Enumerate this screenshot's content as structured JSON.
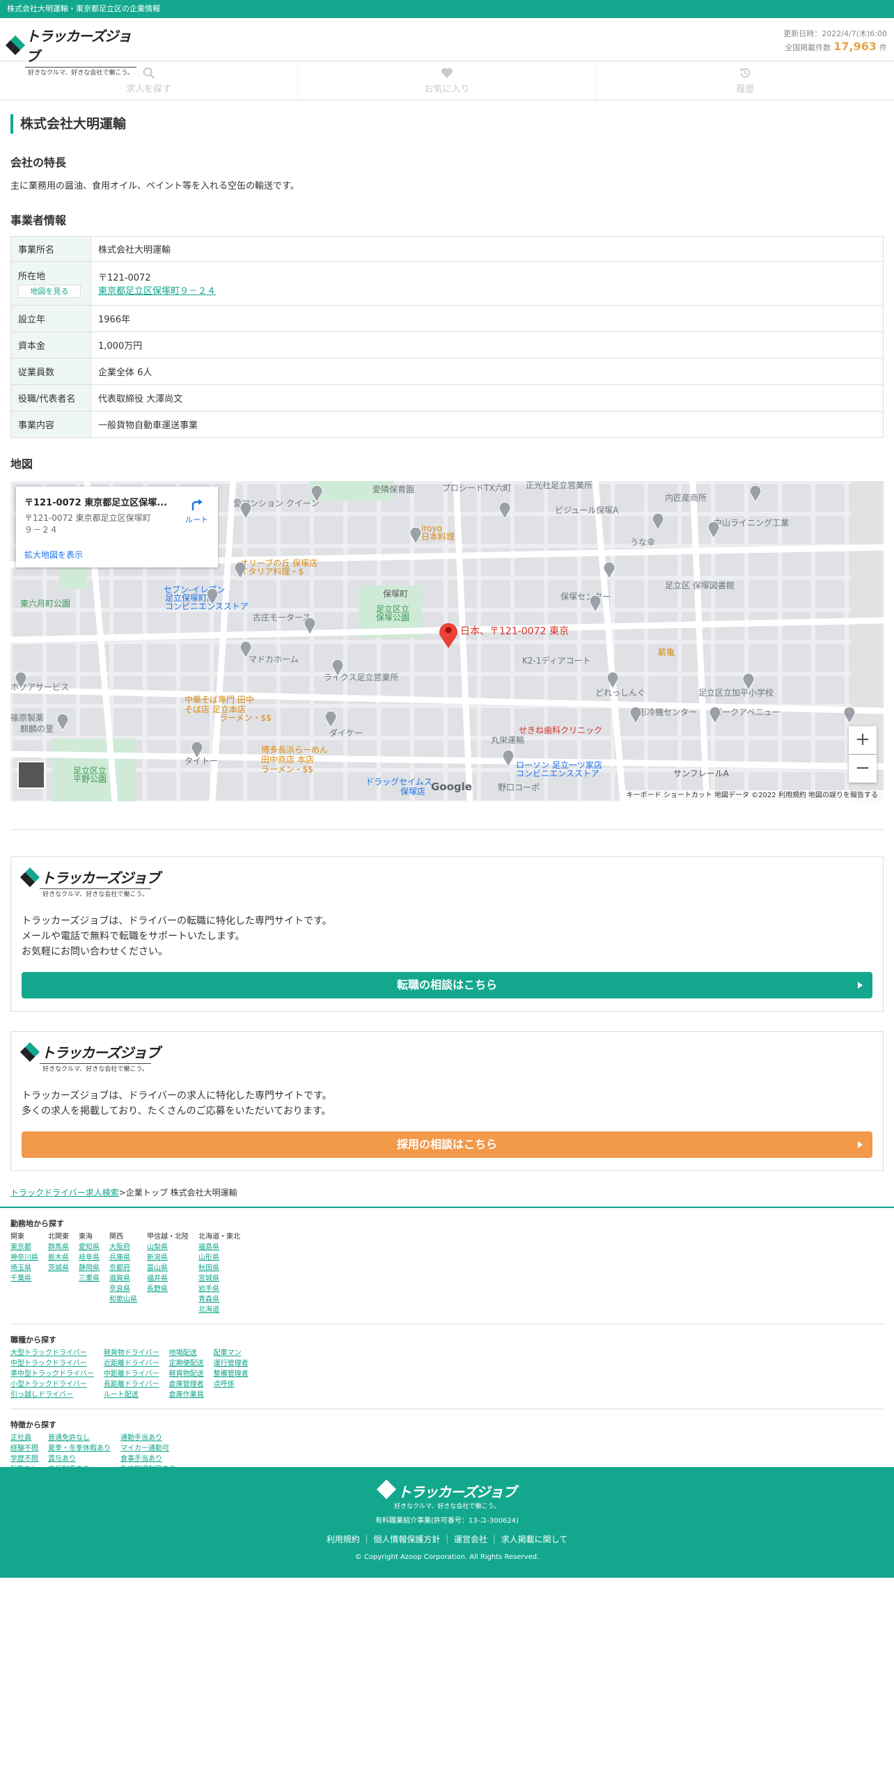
{
  "topbar": {
    "text": "株式会社大明運輸・東京都足立区の企業情報"
  },
  "header": {
    "logo_text": "トラッカーズジョブ",
    "logo_tagline": "好きなクルマ、好きな会社で働こう。",
    "updated_label": "更新日時：2022/4/7(木)6:00",
    "total_label": "全国掲載件数",
    "total_count": "17,963",
    "total_unit": "件"
  },
  "nav": {
    "items": [
      {
        "label": "求人を探す",
        "icon": "search-icon"
      },
      {
        "label": "お気に入り",
        "icon": "heart-icon"
      },
      {
        "label": "履歴",
        "icon": "history-icon"
      }
    ]
  },
  "company": {
    "name": "株式会社大明運輸",
    "features_heading": "会社の特長",
    "features_text": "主に業務用の醤油、食用オイル、ペイント等を入れる空缶の輸送です。",
    "info_heading": "事業者情報",
    "info": [
      {
        "label": "事業所名",
        "value": "株式会社大明運輸"
      },
      {
        "label": "所在地",
        "value": "〒121-0072",
        "link": "東京都足立区保塚町９－２４",
        "map_button": "地図を見る"
      },
      {
        "label": "設立年",
        "value": "1966年"
      },
      {
        "label": "資本金",
        "value": "1,000万円"
      },
      {
        "label": "従業員数",
        "value": "企業全体 6人"
      },
      {
        "label": "役職/代表者名",
        "value": "代表取締役 大澤尚文"
      },
      {
        "label": "事業内容",
        "value": "一般貨物自動車運送事業"
      }
    ]
  },
  "map": {
    "heading": "地図",
    "card_title": "〒121-0072 東京都足立区保塚...",
    "card_address": "〒121-0072 東京都足立区保塚町９－２４",
    "route_label": "ルート",
    "enlarge_label": "拡大地図を表示",
    "pin_label": "日本、〒121-0072 東京",
    "zoom_in": "+",
    "zoom_out": "−",
    "footer_text": "キーボード ショートカット  地図データ ©2022  利用規約  地図の誤りを報告する",
    "google": "Google",
    "places": [
      "愛隣保育園",
      "プロシードTX六町",
      "正光社足立営業所",
      "内匠産商所",
      "ビジュール保塚A",
      "中山ライニング工業",
      "うな幸",
      "足立区 保塚図書館",
      "保塚センター",
      "iroyo",
      "日本料理",
      "オリーブの丘 保塚店",
      "イタリア料理・$",
      "セブン-イレブン",
      "足立保塚町店",
      "コンビニエンスストア",
      "保塚町",
      "足立区立",
      "保塚公園",
      "東六月町公園",
      "古庄モータース",
      "マドカホーム",
      "K2-1ディアコート",
      "薪亀",
      "どれっしんぐ",
      "足立区立加平小学校",
      "ライクス足立営業所",
      "中華そば専門 田中",
      "そば店 足立本店",
      "ラーメン・$$",
      "足立区立",
      "平野公園",
      "博多長浜らーめん",
      "田中商店 本店",
      "ラーメン・$$",
      "ドラッグセイムス",
      "保塚店",
      "丸栄運輸",
      "せきね歯科クリニック",
      "ローソン 足立一ツ家店",
      "コンビニエンスストア",
      "鎌形冷機センター",
      "パークアベニュー",
      "サンフレールA",
      "ダイケー",
      "タイトー",
      "ホクアサービス",
      "篠原製薬",
      "野口コーポ",
      "愛マンション クイーン",
      "麒麟の里"
    ]
  },
  "cta1": {
    "logo_text": "トラッカーズジョブ",
    "logo_tagline": "好きなクルマ、好きな会社で働こう。",
    "lines": [
      "トラッカーズジョブは、ドライバーの転職に特化した専門サイトです。",
      "メールや電話で無料で転職をサポートいたします。",
      "お気軽にお問い合わせください。"
    ],
    "button": "転職の相談はこちら",
    "color": "#13a88e"
  },
  "cta2": {
    "logo_text": "トラッカーズジョブ",
    "logo_tagline": "好きなクルマ、好きな会社で働こう。",
    "lines": [
      "トラッカーズジョブは、ドライバーの求人に特化した専門サイトです。",
      "多くの求人を掲載しており、たくさんのご応募をいただいております。"
    ],
    "button": "採用の相談はこちら",
    "color": "#f2994a"
  },
  "breadcrumb": {
    "link": "トラックドライバー求人検索",
    "sep": ">",
    "rest": "企業トップ 株式会社大明運輸"
  },
  "footer_links": {
    "area_title": "勤務地から探す",
    "areas": [
      {
        "head": "関東",
        "items": [
          "東京都",
          "神奈川県",
          "埼玉県",
          "千葉県"
        ]
      },
      {
        "head": "北関東",
        "items": [
          "群馬県",
          "栃木県",
          "茨城県"
        ]
      },
      {
        "head": "東海",
        "items": [
          "愛知県",
          "岐阜県",
          "静岡県",
          "三重県"
        ]
      },
      {
        "head": "関西",
        "items": [
          "大阪府",
          "兵庫県",
          "京都府",
          "滋賀県",
          "奈良県",
          "和歌山県"
        ]
      },
      {
        "head": "甲信越・北陸",
        "items": [
          "山梨県",
          "新潟県",
          "富山県",
          "福井県",
          "長野県"
        ]
      },
      {
        "head": "北海道・東北",
        "items": [
          "福島県",
          "山形県",
          "秋田県",
          "宮城県",
          "岩手県",
          "青森県",
          "北海道"
        ]
      }
    ],
    "job_title": "職種から探す",
    "jobs": [
      [
        "大型トラックドライバー",
        "中型トラックドライバー",
        "準中型トラックドライバー",
        "小型トラックドライバー",
        "引っ越しドライバー"
      ],
      [
        "軽貨物ドライバー",
        "近距離ドライバー",
        "中距離ドライバー",
        "長距離ドライバー",
        "ルート配送"
      ],
      [
        "地場配送",
        "定期便配送",
        "軽貨物配送",
        "倉庫管理者",
        "倉庫作業員"
      ],
      [
        "配車マン",
        "運行管理者",
        "整備管理者",
        "点呼係"
      ]
    ],
    "feature_title": "特徴から探す",
    "features": [
      [
        "正社員",
        "経験不問",
        "学歴不問",
        "転勤なし"
      ],
      [
        "普通免許なし",
        "夏季・冬季休暇あり",
        "賞与あり",
        "交代制度あり"
      ],
      [
        "通勤手当あり",
        "マイカー通勤可",
        "食事手当あり",
        "免許取得制度あり"
      ]
    ]
  },
  "footer": {
    "logo_text": "トラッカーズジョブ",
    "logo_tagline": "好きなクルマ、好きな会社で働こう。",
    "license": "有料職業紹介事業(許可番号：13-ユ-300624)",
    "links": [
      "利用規約",
      "個人情報保護方針",
      "運営会社",
      "求人掲載に関して"
    ],
    "copyright": "© Copyright Azoop Corporation. All Rights Reserved."
  }
}
